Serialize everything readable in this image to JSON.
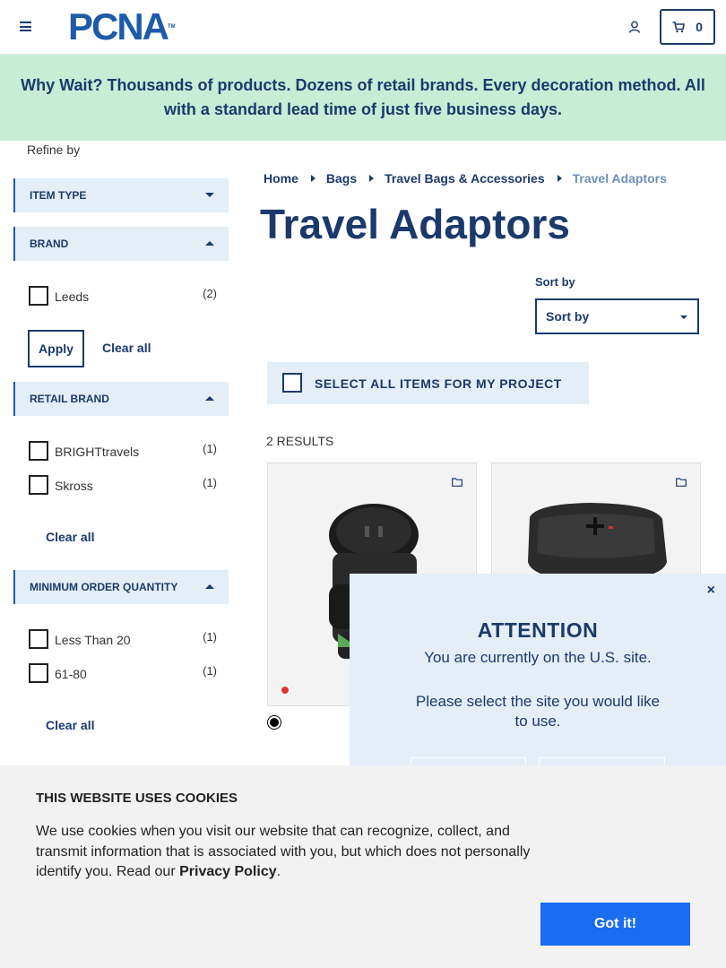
{
  "header": {
    "logo": "PCNA",
    "logo_tm": "TM",
    "cart_count": "0"
  },
  "banner": {
    "text": "Why Wait? Thousands of products. Dozens of retail brands. Every decoration method. All with a standard lead time of just five business days."
  },
  "sidebar": {
    "refine_label": "Refine by",
    "apply_label": "Apply",
    "clear_all_label": "Clear all",
    "facets": [
      {
        "title": "ITEM TYPE",
        "state": "collapsed",
        "options": []
      },
      {
        "title": "BRAND",
        "state": "expanded",
        "options": [
          {
            "label": "Leeds",
            "count": "(2)"
          }
        ]
      },
      {
        "title": "RETAIL BRAND",
        "state": "expanded",
        "options": [
          {
            "label": "BRIGHTtravels",
            "count": "(1)"
          },
          {
            "label": "Skross",
            "count": "(1)"
          }
        ]
      },
      {
        "title": "MINIMUM ORDER QUANTITY",
        "state": "expanded",
        "options": [
          {
            "label": "Less Than 20",
            "count": "(1)"
          },
          {
            "label": "61-80",
            "count": "(1)"
          }
        ]
      }
    ]
  },
  "breadcrumb": [
    "Home",
    "Bags",
    "Travel Bags & Accessories",
    "Travel Adaptors"
  ],
  "page_title": "Travel Adaptors",
  "sort": {
    "label": "Sort by",
    "selected": "Sort by"
  },
  "select_all_label": "SELECT ALL ITEMS FOR MY PROJECT",
  "results_count": "2 RESULTS",
  "modal": {
    "close": "×",
    "title": "ATTENTION",
    "line1": "You are currently on the U.S. site.",
    "line2": "Please select the site you would like to use."
  },
  "cookie": {
    "title": "THIS WEBSITE USES COOKIES",
    "body": "We use cookies when you visit our website that can recognize, collect, and transmit information that is associated with you, but which does not personally identify you. Read our ",
    "link": "Privacy Policy",
    "end": ".",
    "button": "Got it!"
  },
  "colors": {
    "brand_navy": "#1b3a6b",
    "brand_blue": "#1e5aa8",
    "banner_bg": "#c8ecd6",
    "facet_bg": "#e4eef7",
    "cookie_button": "#1a6df0"
  }
}
